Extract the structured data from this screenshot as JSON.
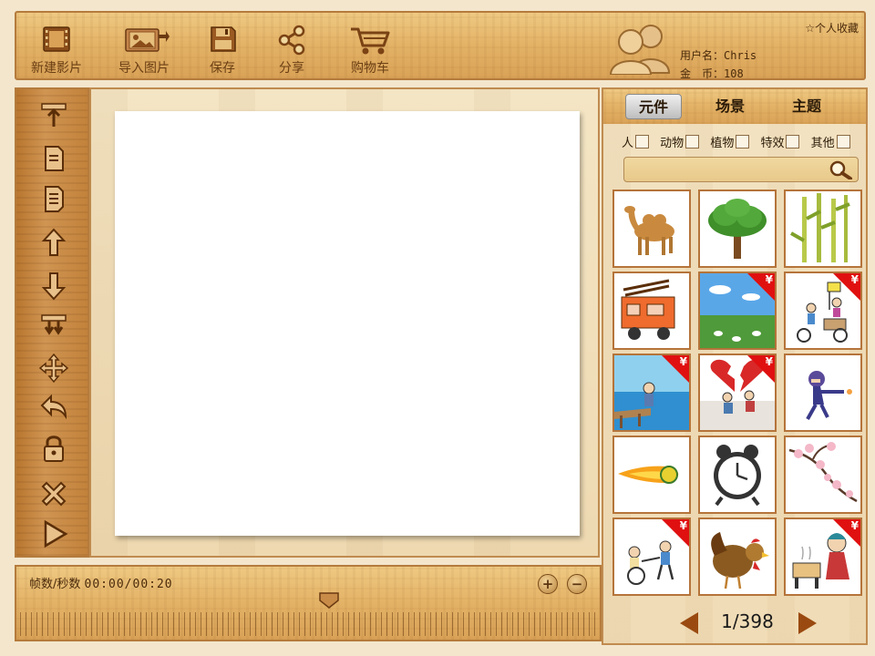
{
  "toolbar": {
    "new_movie": "新建影片",
    "import_image": "导入图片",
    "save": "保存",
    "share": "分享",
    "cart": "购物车"
  },
  "user": {
    "name_label": "用户名：",
    "name_value": "Chris",
    "coins_label": "金　币：",
    "coins_value": "108",
    "favorites": "个人收藏"
  },
  "left_tools": [
    "bring-to-top",
    "layer-up-page",
    "layer-down-page",
    "move-up",
    "move-down",
    "send-to-bottom",
    "move",
    "undo",
    "lock",
    "delete",
    "play"
  ],
  "timeline": {
    "fps_label": "帧数/秒数",
    "current_time": "00:00",
    "separator": "/",
    "total_time": "00:20"
  },
  "panel": {
    "tabs": [
      "元件",
      "场景",
      "主题"
    ],
    "active_tab": 0,
    "filters": [
      "人",
      "动物",
      "植物",
      "特效",
      "其他"
    ],
    "search_placeholder": "",
    "price_mark": "¥",
    "items": [
      {
        "name": "camel",
        "paid": false
      },
      {
        "name": "tree",
        "paid": false
      },
      {
        "name": "bamboo",
        "paid": false
      },
      {
        "name": "fire-truck",
        "paid": false
      },
      {
        "name": "grassland-scene",
        "paid": true
      },
      {
        "name": "tricycle-riders",
        "paid": true
      },
      {
        "name": "pier-scene",
        "paid": true
      },
      {
        "name": "broken-heart-scene",
        "paid": true
      },
      {
        "name": "running-ninja",
        "paid": false
      },
      {
        "name": "fireball",
        "paid": false
      },
      {
        "name": "alarm-clock",
        "paid": false
      },
      {
        "name": "peach-blossom",
        "paid": false
      },
      {
        "name": "wheelchair-kids",
        "paid": true
      },
      {
        "name": "rooster",
        "paid": false
      },
      {
        "name": "girl-at-stove",
        "paid": true
      }
    ],
    "page_current": "1",
    "page_total": "398",
    "page_display": "1/398"
  },
  "colors": {
    "wood_light": "#efc982",
    "wood_border": "#b57b3c",
    "price_tag": "#e01010",
    "arrow": "#9a4a10"
  }
}
